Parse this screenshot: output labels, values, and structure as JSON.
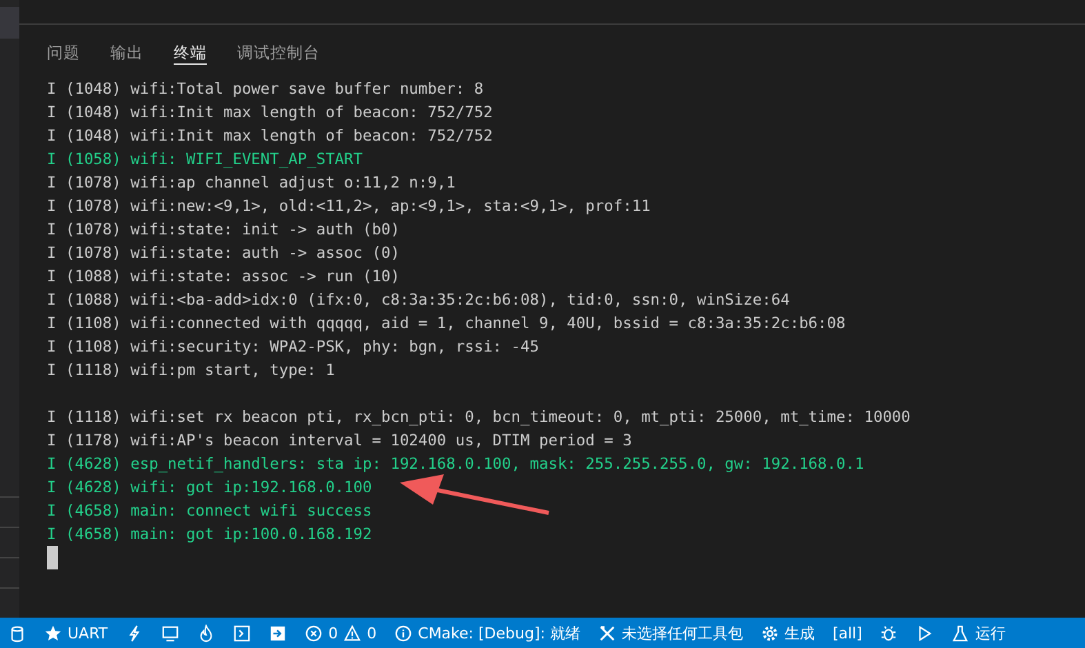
{
  "tabs": [
    {
      "label": "问题",
      "selected": false
    },
    {
      "label": "输出",
      "selected": false
    },
    {
      "label": "终端",
      "selected": true
    },
    {
      "label": "调试控制台",
      "selected": false
    }
  ],
  "terminal": {
    "lines": [
      {
        "kind": "info",
        "text": "I (1048) wifi:Total power save buffer number: 8"
      },
      {
        "kind": "info",
        "text": "I (1048) wifi:Init max length of beacon: 752/752"
      },
      {
        "kind": "info",
        "text": "I (1048) wifi:Init max length of beacon: 752/752"
      },
      {
        "kind": "success",
        "text": "I (1058) wifi: WIFI_EVENT_AP_START"
      },
      {
        "kind": "info",
        "text": "I (1078) wifi:ap channel adjust o:11,2 n:9,1"
      },
      {
        "kind": "info",
        "text": "I (1078) wifi:new:<9,1>, old:<11,2>, ap:<9,1>, sta:<9,1>, prof:11"
      },
      {
        "kind": "info",
        "text": "I (1078) wifi:state: init -> auth (b0)"
      },
      {
        "kind": "info",
        "text": "I (1078) wifi:state: auth -> assoc (0)"
      },
      {
        "kind": "info",
        "text": "I (1088) wifi:state: assoc -> run (10)"
      },
      {
        "kind": "info",
        "text": "I (1088) wifi:<ba-add>idx:0 (ifx:0, c8:3a:35:2c:b6:08), tid:0, ssn:0, winSize:64"
      },
      {
        "kind": "info",
        "text": "I (1108) wifi:connected with qqqqq, aid = 1, channel 9, 40U, bssid = c8:3a:35:2c:b6:08"
      },
      {
        "kind": "info",
        "text": "I (1108) wifi:security: WPA2-PSK, phy: bgn, rssi: -45"
      },
      {
        "kind": "info",
        "text": "I (1118) wifi:pm start, type: 1"
      },
      {
        "kind": "blank"
      },
      {
        "kind": "info",
        "text": "I (1118) wifi:set rx beacon pti, rx_bcn_pti: 0, bcn_timeout: 0, mt_pti: 25000, mt_time: 10000"
      },
      {
        "kind": "info",
        "text": "I (1178) wifi:AP's beacon interval = 102400 us, DTIM period = 3"
      },
      {
        "kind": "success",
        "text": "I (4628) esp_netif_handlers: sta ip: 192.168.0.100, mask: 255.255.255.0, gw: 192.168.0.1"
      },
      {
        "kind": "success",
        "text": "I (4628) wifi: got ip:192.168.0.100"
      },
      {
        "kind": "success",
        "text": "I (4658) main: connect wifi success"
      },
      {
        "kind": "success",
        "text": "I (4658) main: got ip:100.0.168.192"
      }
    ]
  },
  "status_bar": [
    {
      "kind": "icon"
    },
    {
      "kind": "item",
      "text": "UART"
    },
    {
      "kind": "icon"
    },
    {
      "kind": "icon"
    },
    {
      "kind": "icon"
    },
    {
      "kind": "icon"
    },
    {
      "kind": "icon"
    },
    {
      "kind": "problems",
      "errors": "0",
      "warnings": "0"
    },
    {
      "kind": "item",
      "text": "CMake: [Debug]: 就绪"
    },
    {
      "kind": "item",
      "text": "未选择任何工具包"
    },
    {
      "kind": "item",
      "text": "生成"
    },
    {
      "kind": "item",
      "text": "[all]"
    },
    {
      "kind": "icon"
    },
    {
      "kind": "icon"
    },
    {
      "kind": "item",
      "text": "运行"
    }
  ]
}
